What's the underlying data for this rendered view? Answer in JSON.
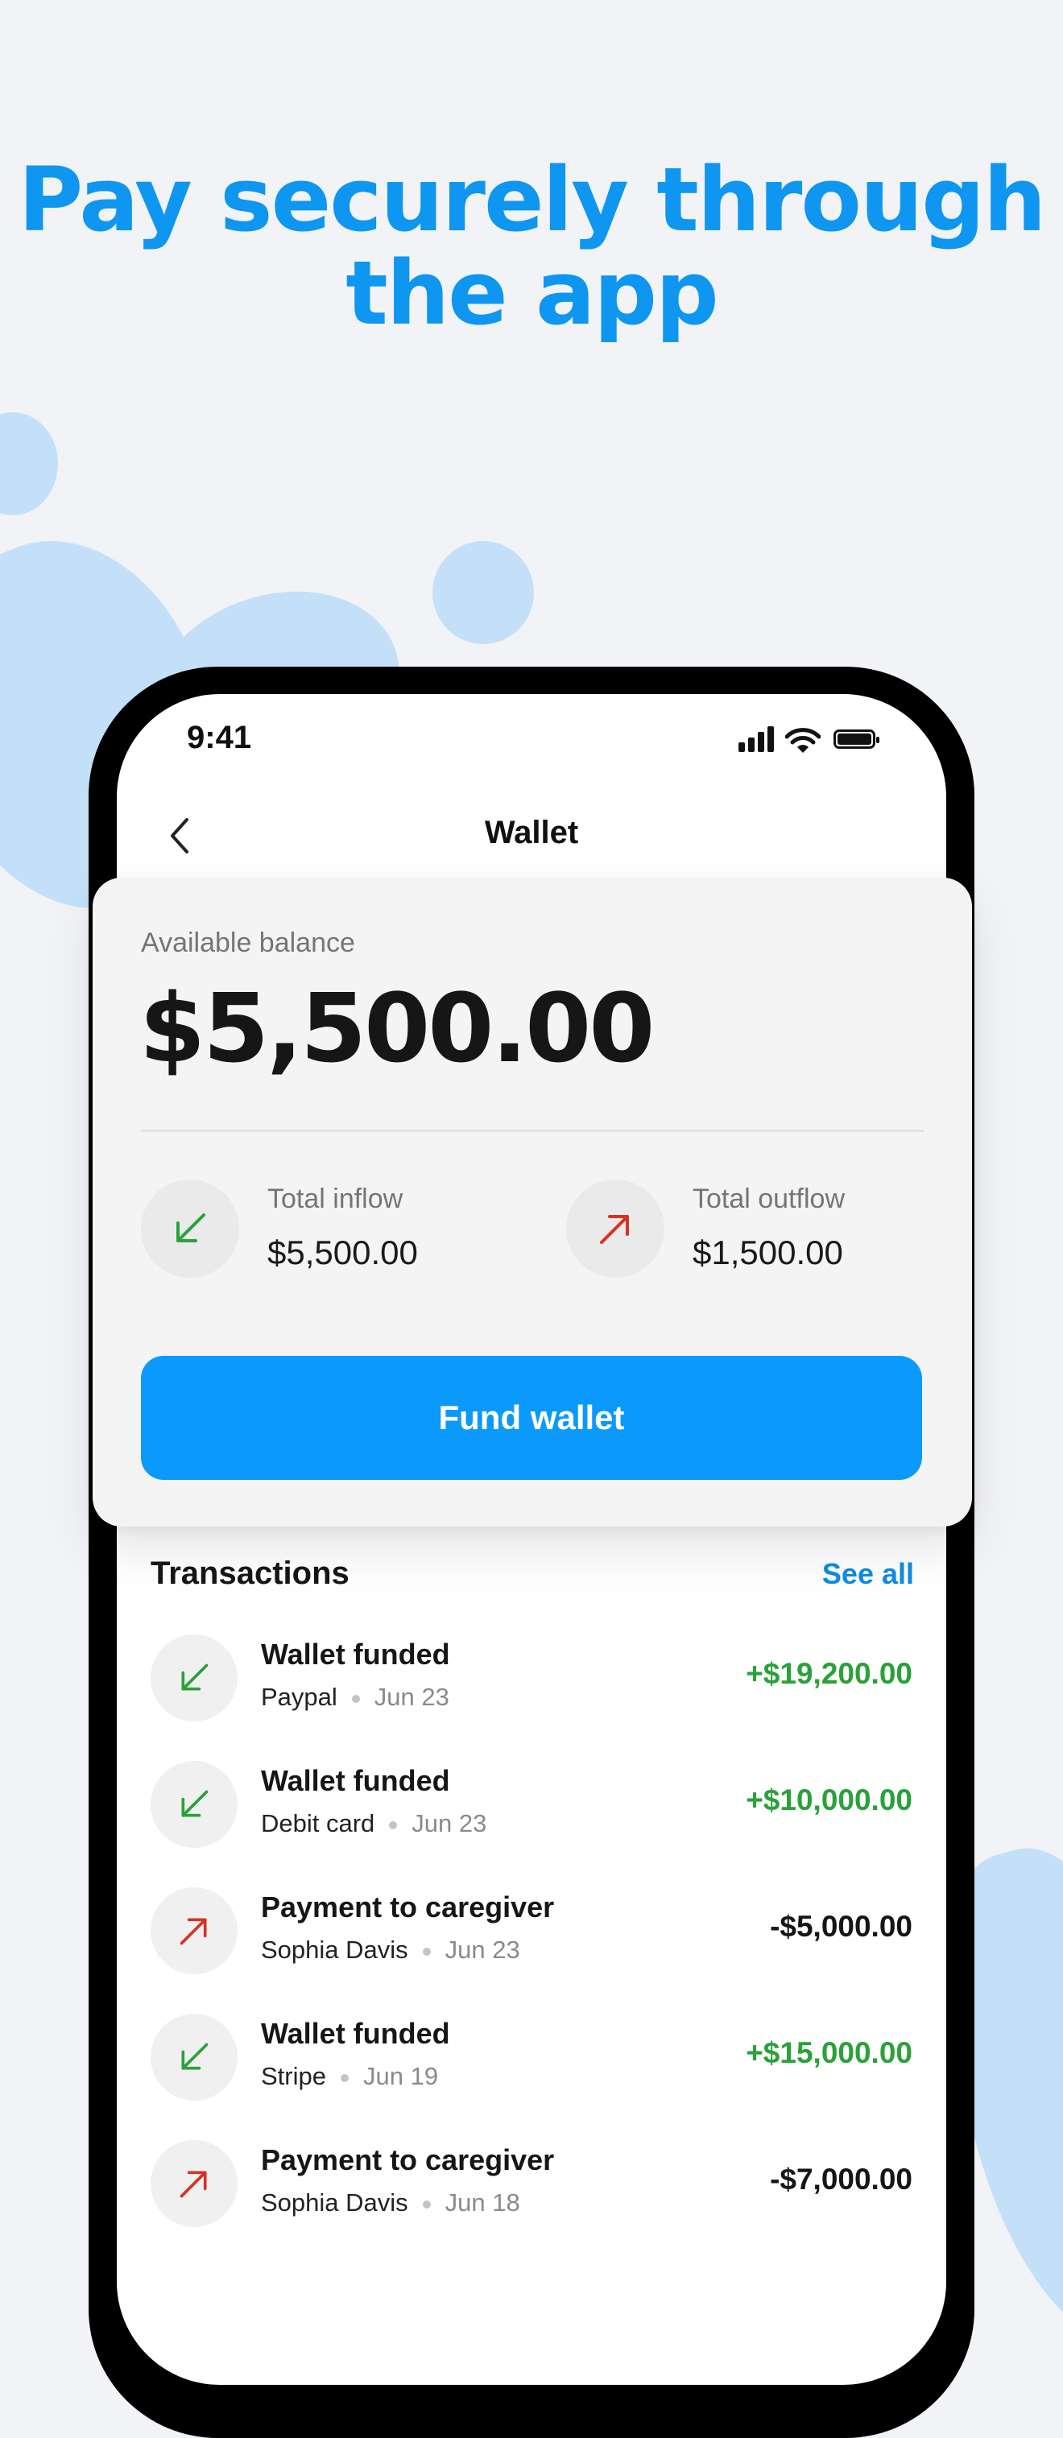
{
  "headline": {
    "line1": "Pay securely through",
    "line2": "the app"
  },
  "status_bar": {
    "time": "9:41"
  },
  "nav": {
    "title": "Wallet",
    "back_icon": "chevron-left-icon"
  },
  "balance": {
    "label": "Available balance",
    "amount": "$5,500.00",
    "inflow": {
      "label": "Total inflow",
      "value": "$5,500.00",
      "icon": "arrow-down-left-icon"
    },
    "outflow": {
      "label": "Total outflow",
      "value": "$1,500.00",
      "icon": "arrow-up-right-icon"
    },
    "fund_button": "Fund wallet"
  },
  "transactions": {
    "header": "Transactions",
    "see_all": "See all",
    "items": [
      {
        "title": "Wallet funded",
        "source": "Paypal",
        "date": "Jun 23",
        "amount": "+$19,200.00",
        "type": "in"
      },
      {
        "title": "Wallet funded",
        "source": "Debit card",
        "date": "Jun 23",
        "amount": "+$10,000.00",
        "type": "in"
      },
      {
        "title": "Payment to caregiver",
        "source": "Sophia Davis",
        "date": "Jun 23",
        "amount": "-$5,000.00",
        "type": "out"
      },
      {
        "title": "Wallet funded",
        "source": "Stripe",
        "date": "Jun 19",
        "amount": "+$15,000.00",
        "type": "in"
      },
      {
        "title": "Payment to caregiver",
        "source": "Sophia Davis",
        "date": "Jun 18",
        "amount": "-$7,000.00",
        "type": "out"
      }
    ]
  },
  "colors": {
    "accent": "#0B99FB",
    "headline": "#0E96F0",
    "inflow": "#2AA13A",
    "outflow": "#D93025",
    "background": "#F2F3F7"
  }
}
